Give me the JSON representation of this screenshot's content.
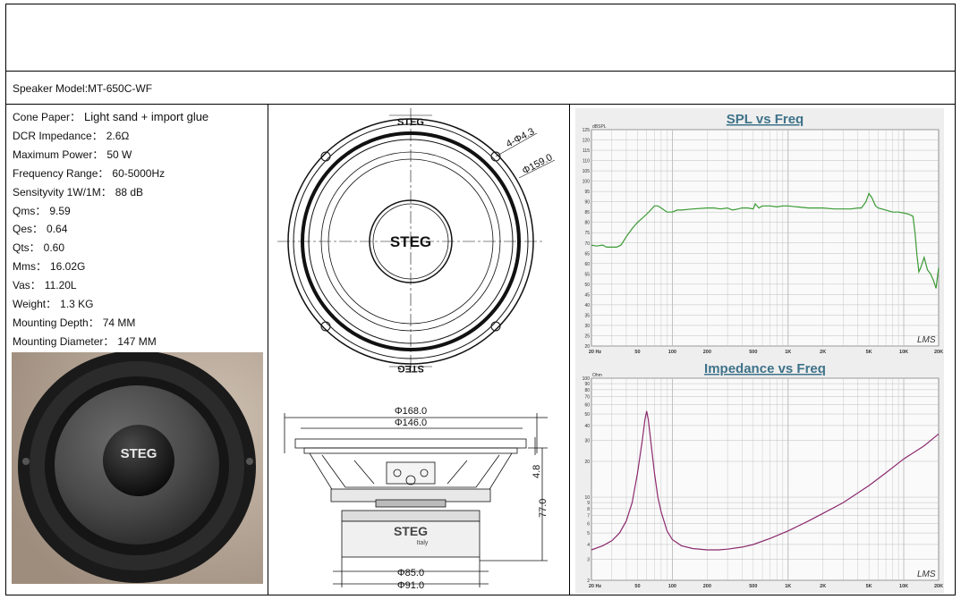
{
  "model": {
    "text": "Speaker Model:MT-650C-WF"
  },
  "specs": [
    {
      "label": "Cone Paper：",
      "value": "Light sand + import glue"
    },
    {
      "label": "DCR Impedance：",
      "value": "2.6Ω"
    },
    {
      "label": "Maximum Power：",
      "value": "50 W"
    },
    {
      "label": "Frequency Range：",
      "value": "60-5000Hz"
    },
    {
      "label": "Sensityvity 1W/1M：",
      "value": "88 dB"
    },
    {
      "label": "Qms：",
      "value": "9.59"
    },
    {
      "label": "Qes：",
      "value": "0.64"
    },
    {
      "label": "Qts：",
      "value": "0.60"
    },
    {
      "label": "Mms：",
      "value": "16.02G"
    },
    {
      "label": "Vas：",
      "value": "11.20L"
    },
    {
      "label": "Weight：",
      "value": "1.3 KG"
    },
    {
      "label": "Mounting Depth：",
      "value": "74 MM"
    },
    {
      "label": "Mounting Diameter：",
      "value": "147 MM"
    }
  ],
  "photo": {
    "brand": "STEG"
  },
  "drawing_front": {
    "brand_top": "STEG",
    "brand_center": "STEG",
    "brand_bottom": "STEG",
    "hole_dim": "4-Φ4.3",
    "diameter_dim": "Φ159.0"
  },
  "drawing_side": {
    "dim_outer": "Φ168.0",
    "dim_cutout": "Φ146.0",
    "dim_flange": "4.8",
    "dim_depth": "77.0",
    "dim_magnet_inner": "Φ85.0",
    "dim_magnet_outer": "Φ91.0",
    "magnet_brand": "STEG",
    "magnet_sub": "Italy"
  },
  "chart_data": [
    {
      "type": "line",
      "title": "SPL vs Freq",
      "ylabel": "dBSPL",
      "xscale": "log",
      "xlim": [
        20,
        20000
      ],
      "ylim": [
        20,
        125
      ],
      "grid": true,
      "watermark": "LMS",
      "xticks": [
        {
          "v": 20,
          "t": "20 Hz"
        },
        {
          "v": 50,
          "t": "50"
        },
        {
          "v": 100,
          "t": "100"
        },
        {
          "v": 200,
          "t": "200"
        },
        {
          "v": 500,
          "t": "500"
        },
        {
          "v": 1000,
          "t": "1K"
        },
        {
          "v": 2000,
          "t": "2K"
        },
        {
          "v": 5000,
          "t": "5K"
        },
        {
          "v": 10000,
          "t": "10K"
        },
        {
          "v": 20000,
          "t": "20K"
        }
      ],
      "yticks": [
        20,
        25,
        30,
        35,
        40,
        45,
        50,
        55,
        60,
        65,
        70,
        75,
        80,
        85,
        90,
        95,
        100,
        105,
        110,
        115,
        120,
        125
      ],
      "series": [
        {
          "color": "#3a9a34",
          "x": [
            20,
            22,
            25,
            27,
            30,
            33,
            36,
            40,
            45,
            50,
            55,
            60,
            65,
            70,
            75,
            80,
            90,
            100,
            110,
            120,
            150,
            200,
            230,
            260,
            300,
            330,
            370,
            400,
            450,
            500,
            520,
            560,
            600,
            700,
            800,
            900,
            1000,
            1200,
            1500,
            1700,
            2000,
            2500,
            3000,
            3500,
            4000,
            4300,
            4700,
            5000,
            5300,
            5700,
            6000,
            7000,
            8000,
            9000,
            10000,
            11000,
            12000,
            12500,
            13000,
            13500,
            14000,
            15000,
            16000,
            17000,
            18000,
            19000,
            20000
          ],
          "y": [
            69,
            68.5,
            69,
            68,
            68,
            68,
            69,
            73,
            77,
            80,
            82,
            84,
            86,
            88,
            88,
            87,
            85,
            85,
            86,
            86,
            86.5,
            87,
            87,
            86.5,
            87,
            86,
            86.5,
            87,
            87,
            86.5,
            89,
            87,
            88,
            88,
            87.5,
            88,
            88,
            87.5,
            87,
            87,
            87,
            86.5,
            86.5,
            86.5,
            87,
            87,
            90,
            94,
            92,
            88,
            87,
            86,
            85,
            85,
            84.5,
            84,
            83,
            75,
            64,
            56,
            58,
            63,
            57,
            55,
            52,
            48,
            58
          ]
        }
      ]
    },
    {
      "type": "line",
      "title": "Impedance vs Freq",
      "ylabel": "Ohm",
      "xscale": "log",
      "yscale": "log",
      "xlim": [
        20,
        20000
      ],
      "ylim": [
        2,
        100
      ],
      "grid": true,
      "watermark": "LMS",
      "xticks": [
        {
          "v": 20,
          "t": "20 Hz"
        },
        {
          "v": 50,
          "t": "50"
        },
        {
          "v": 100,
          "t": "100"
        },
        {
          "v": 200,
          "t": "200"
        },
        {
          "v": 500,
          "t": "500"
        },
        {
          "v": 1000,
          "t": "1K"
        },
        {
          "v": 2000,
          "t": "2K"
        },
        {
          "v": 5000,
          "t": "5K"
        },
        {
          "v": 10000,
          "t": "10K"
        },
        {
          "v": 20000,
          "t": "20K"
        }
      ],
      "yticks": [
        {
          "v": 2,
          "t": "2"
        },
        {
          "v": 3,
          "t": "3"
        },
        {
          "v": 4,
          "t": "4"
        },
        {
          "v": 5,
          "t": "5"
        },
        {
          "v": 6,
          "t": "6"
        },
        {
          "v": 7,
          "t": "7"
        },
        {
          "v": 8,
          "t": "8"
        },
        {
          "v": 9,
          "t": "9"
        },
        {
          "v": 10,
          "t": "10"
        },
        {
          "v": 20,
          "t": "20"
        },
        {
          "v": 30,
          "t": "30"
        },
        {
          "v": 40,
          "t": "40"
        },
        {
          "v": 50,
          "t": "50"
        },
        {
          "v": 60,
          "t": "60"
        },
        {
          "v": 70,
          "t": "70"
        },
        {
          "v": 80,
          "t": "80"
        },
        {
          "v": 90,
          "t": "90"
        },
        {
          "v": 100,
          "t": "100"
        }
      ],
      "series": [
        {
          "color": "#8b2a6e",
          "x": [
            20,
            25,
            30,
            35,
            40,
            45,
            50,
            55,
            58,
            60,
            62,
            65,
            70,
            75,
            80,
            90,
            100,
            120,
            150,
            200,
            250,
            300,
            400,
            500,
            700,
            1000,
            1500,
            2000,
            3000,
            5000,
            7000,
            10000,
            15000,
            20000
          ],
          "y": [
            3.6,
            3.9,
            4.3,
            5.0,
            6.3,
            9.0,
            16,
            30,
            45,
            53,
            45,
            30,
            16,
            10,
            7.5,
            5.2,
            4.4,
            3.9,
            3.7,
            3.6,
            3.6,
            3.65,
            3.8,
            4.0,
            4.5,
            5.2,
            6.3,
            7.3,
            9.0,
            12.5,
            16,
            21,
            27,
            34
          ]
        }
      ]
    }
  ]
}
